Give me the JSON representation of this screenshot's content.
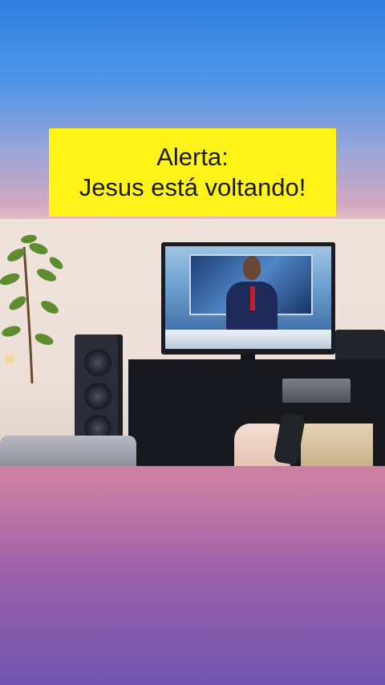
{
  "caption": {
    "line1": "Alerta:",
    "line2": "Jesus está voltando!"
  },
  "colors": {
    "caption_background": "#fff31a",
    "caption_text": "#1a1a1a",
    "background_top": "#2f7fe0",
    "background_bottom": "#6a54b0"
  }
}
